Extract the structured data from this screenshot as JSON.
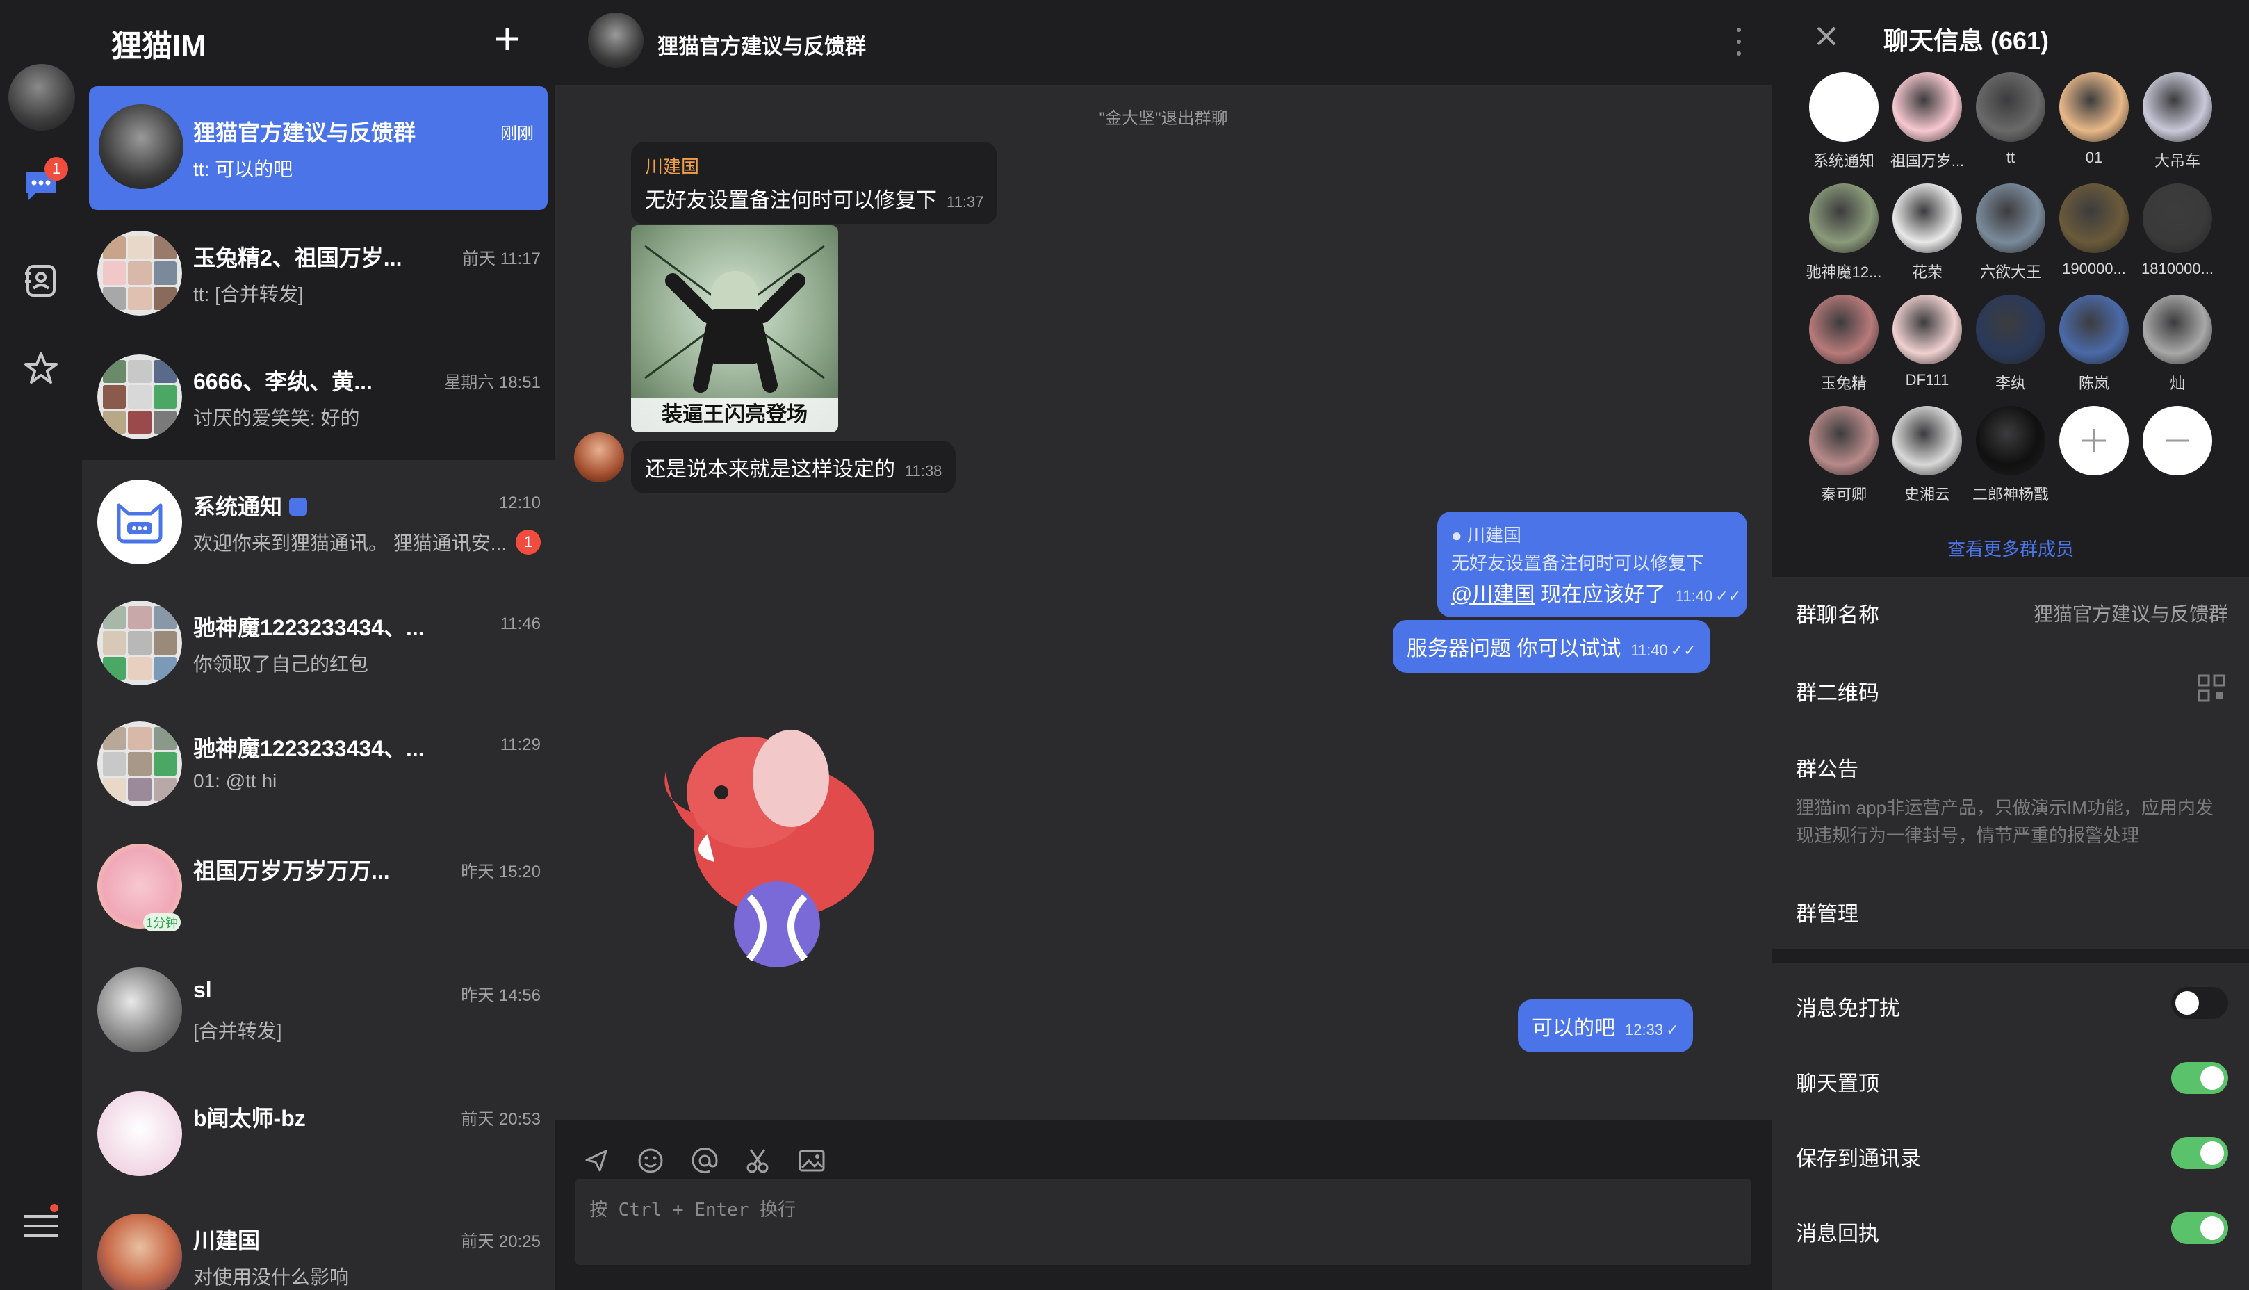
{
  "app": {
    "title": "狸猫IM"
  },
  "rail": {
    "unread_badge": "1"
  },
  "chat_list": [
    {
      "name": "狸猫官方建议与反馈群",
      "time": "刚刚",
      "preview": "tt: 可以的吧"
    },
    {
      "name": "玉兔精2、祖国万岁...",
      "time": "前天 11:17",
      "preview": "tt: [合并转发]"
    },
    {
      "name": "6666、李纨、黄...",
      "time": "星期六 18:51",
      "preview": "讨厌的爱笑笑: 好的"
    },
    {
      "name": "系统通知",
      "time": "12:10",
      "preview": "欢迎你来到狸猫通讯。 狸猫通讯安...",
      "unread": "1"
    },
    {
      "name": "驰神魔1223233434、...",
      "time": "11:46",
      "preview": "你领取了自己的红包"
    },
    {
      "name": "驰神魔1223233434、...",
      "time": "11:29",
      "preview": "01: @tt hi"
    },
    {
      "name": "祖国万岁万岁万万...",
      "time": "昨天 15:20",
      "preview": "",
      "tag": "1分钟"
    },
    {
      "name": "sl",
      "time": "昨天 14:56",
      "preview": "[合并转发]"
    },
    {
      "name": "b闻太师-bz",
      "time": "前天 20:53",
      "preview": ""
    },
    {
      "name": "川建国",
      "time": "前天 20:25",
      "preview": "对使用没什么影响"
    }
  ],
  "conversation": {
    "title": "狸猫官方建议与反馈群",
    "system_message": "\"金大坚\"退出群聊",
    "messages": [
      {
        "sender": "川建国",
        "text": "无好友设置备注何时可以修复下",
        "time": "11:37"
      },
      {
        "sticker_caption": "装逼王闪亮登场"
      },
      {
        "text": "还是说本来就是这样设定的",
        "time": "11:38"
      },
      {
        "quote_sender": "川建国",
        "quote_text": "无好友设置备注何时可以修复下",
        "mention": "@川建国",
        "text": "现在应该好了",
        "time": "11:40"
      },
      {
        "text": "服务器问题 你可以试试",
        "time": "11:40"
      },
      {
        "text": "可以的吧",
        "time": "12:33"
      }
    ],
    "composer_placeholder": "按 Ctrl + Enter 换行"
  },
  "info": {
    "title": "聊天信息 (661)",
    "members": [
      "系统通知",
      "祖国万岁...",
      "tt",
      "01",
      "大吊车",
      "驰神魔12...",
      "花荣",
      "六欲大王",
      "190000...",
      "1810000...",
      "玉兔精",
      "DF111",
      "李纨",
      "陈岚",
      "灿",
      "秦可卿",
      "史湘云",
      "二郎神杨戬"
    ],
    "see_more": "查看更多群成员",
    "group_name_label": "群聊名称",
    "group_name_value": "狸猫官方建议与反馈群",
    "qr_label": "群二维码",
    "notice_label": "群公告",
    "notice_text": "狸猫im app非运营产品，只做演示IM功能，应用内发现违规行为一律封号，情节严重的报警处理",
    "manage_label": "群管理",
    "toggles": [
      {
        "label": "消息免打扰",
        "on": false
      },
      {
        "label": "聊天置顶",
        "on": true
      },
      {
        "label": "保存到通讯录",
        "on": true
      },
      {
        "label": "消息回执",
        "on": true
      }
    ]
  },
  "colors": {
    "accent": "#4a74e8",
    "badge": "#f04d3f",
    "toggle_on": "#5ac26a",
    "sender_name": "#f0a24a"
  }
}
